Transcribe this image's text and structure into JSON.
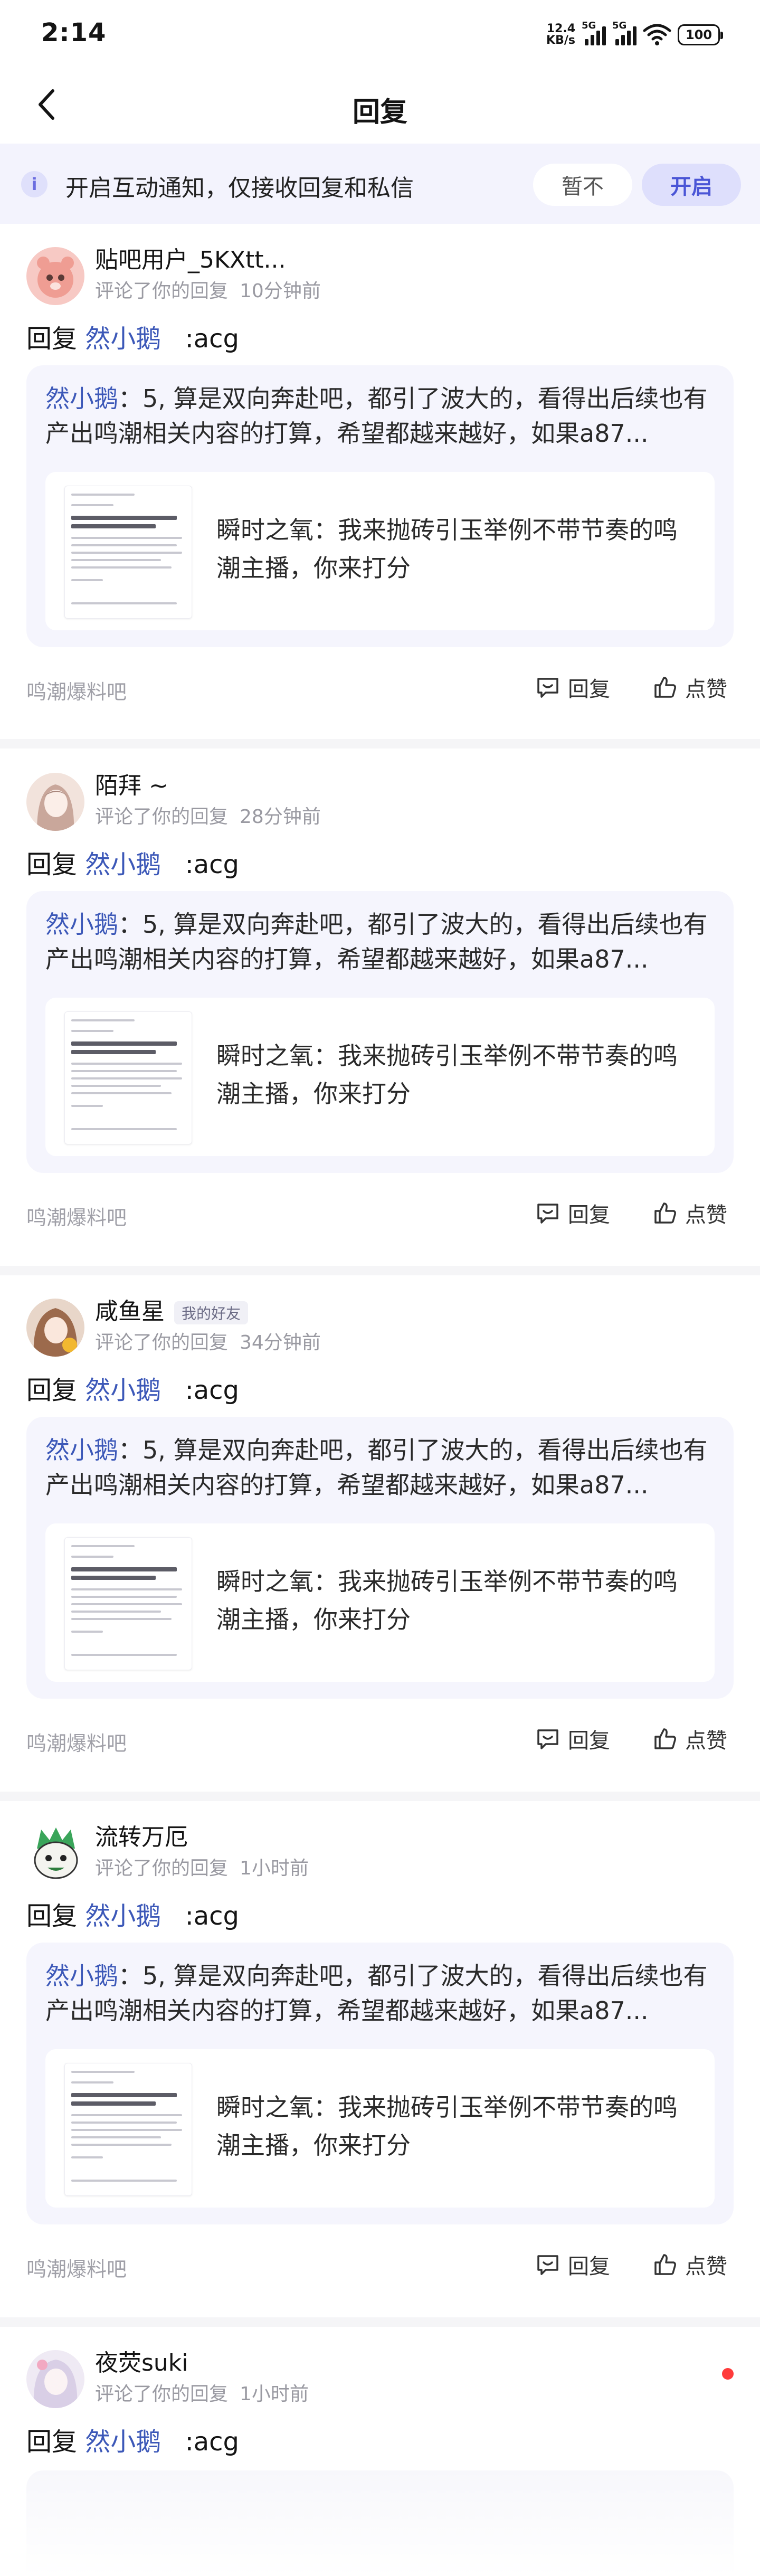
{
  "status_bar": {
    "time": "2:14",
    "net_speed_value": "12.4",
    "net_speed_unit": "KB/s",
    "signal_1_tag": "5G",
    "signal_2_tag": "5G",
    "battery": "100"
  },
  "header": {
    "title": "回复"
  },
  "notice": {
    "icon": "i",
    "text": "开启互动通知，仅接收回复和私信",
    "later_label": "暂不",
    "open_label": "开启"
  },
  "items": [
    {
      "username": "贴吧用户_5KXtt...",
      "friend_tag": "",
      "action": "评论了你的回复",
      "time": "10分钟前",
      "reply_prefix": "回复",
      "reply_target": "然小鹅",
      "reply_text": ":acg",
      "quote_author": "然小鹅",
      "quote_text": "：5, 算是双向奔赴吧，都引了波大的，看得出后续也有产出鸣潮相关内容的打算，希望都越来越好，如果a87...",
      "post_title": "瞬时之氧：我来抛砖引玉举例不带节奏的鸣潮主播，你来打分",
      "forum": "鸣潮爆料吧",
      "reply_label": "回复",
      "like_label": "点赞"
    },
    {
      "username": "陌拜 ~",
      "friend_tag": "",
      "action": "评论了你的回复",
      "time": "28分钟前",
      "reply_prefix": "回复",
      "reply_target": "然小鹅",
      "reply_text": ":acg",
      "quote_author": "然小鹅",
      "quote_text": "：5, 算是双向奔赴吧，都引了波大的，看得出后续也有产出鸣潮相关内容的打算，希望都越来越好，如果a87...",
      "post_title": "瞬时之氧：我来抛砖引玉举例不带节奏的鸣潮主播，你来打分",
      "forum": "鸣潮爆料吧",
      "reply_label": "回复",
      "like_label": "点赞"
    },
    {
      "username": "咸鱼星",
      "friend_tag": "我的好友",
      "action": "评论了你的回复",
      "time": "34分钟前",
      "reply_prefix": "回复",
      "reply_target": "然小鹅",
      "reply_text": ":acg",
      "quote_author": "然小鹅",
      "quote_text": "：5, 算是双向奔赴吧，都引了波大的，看得出后续也有产出鸣潮相关内容的打算，希望都越来越好，如果a87...",
      "post_title": "瞬时之氧：我来抛砖引玉举例不带节奏的鸣潮主播，你来打分",
      "forum": "鸣潮爆料吧",
      "reply_label": "回复",
      "like_label": "点赞"
    },
    {
      "username": "流转万厄",
      "friend_tag": "",
      "action": "评论了你的回复",
      "time": "1小时前",
      "reply_prefix": "回复",
      "reply_target": "然小鹅",
      "reply_text": ":acg",
      "quote_author": "然小鹅",
      "quote_text": "：5, 算是双向奔赴吧，都引了波大的，看得出后续也有产出鸣潮相关内容的打算，希望都越来越好，如果a87...",
      "post_title": "瞬时之氧：我来抛砖引玉举例不带节奏的鸣潮主播，你来打分",
      "forum": "鸣潮爆料吧",
      "reply_label": "回复",
      "like_label": "点赞"
    },
    {
      "username": "夜荧suki",
      "friend_tag": "",
      "action": "评论了你的回复",
      "time": "1小时前",
      "reply_prefix": "回复",
      "reply_target": "然小鹅",
      "reply_text": ":acg"
    }
  ],
  "colors": {
    "accent": "#4a55d6",
    "mention": "#3c58b8",
    "unread_dot": "#ff3b3b"
  }
}
